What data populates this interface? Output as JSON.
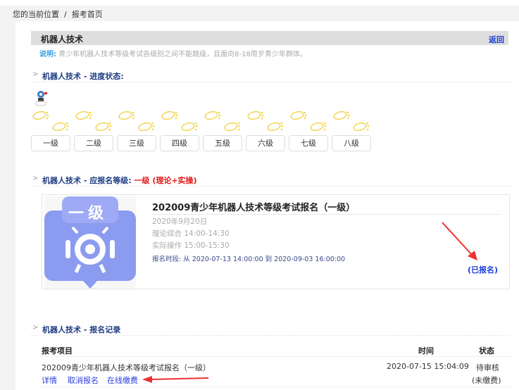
{
  "breadcrumb": {
    "label": "您的当前位置",
    "sep": "/",
    "current": "报考首页"
  },
  "header": {
    "title": "机器人技术",
    "back": "返回"
  },
  "note": {
    "label": "说明:",
    "text": "青少年机器人技术等级考试各级别之间不能跳级，且面向8-18周岁青少年群体。"
  },
  "progress": {
    "title": "机器人技术 - 进度状态:",
    "levels": [
      "一级",
      "二级",
      "三级",
      "四级",
      "五级",
      "六级",
      "七级",
      "八级"
    ],
    "current_level_index": 0
  },
  "apply": {
    "title": "机器人技术 - 应报名等级:",
    "level": "一级",
    "type": "(理论+实操)"
  },
  "card": {
    "badge": "一级",
    "title": "202009青少年机器人技术等级考试报名（一级）",
    "date": "2020年9月20日",
    "theory": "理论综合 14:00-14:30",
    "practice": "实际操作 15:00-15:30",
    "period": "报名时段: 从 2020-07-13 14:00:00 到 2020-09-03 16:00:00",
    "status": "(已报名)",
    "badge_color": "#8b9bf0"
  },
  "records": {
    "title": "机器人技术 - 报名记录",
    "headers": [
      "报考项目",
      "时间",
      "状态"
    ],
    "rows": [
      {
        "item": "202009青少年机器人技术等级考试报名（一级）",
        "time": "2020-07-15 15:04:09",
        "status": "待审核",
        "pay_status": "(未缴费)",
        "actions": [
          "详情",
          "取消报名",
          "在线缴费"
        ]
      }
    ]
  }
}
